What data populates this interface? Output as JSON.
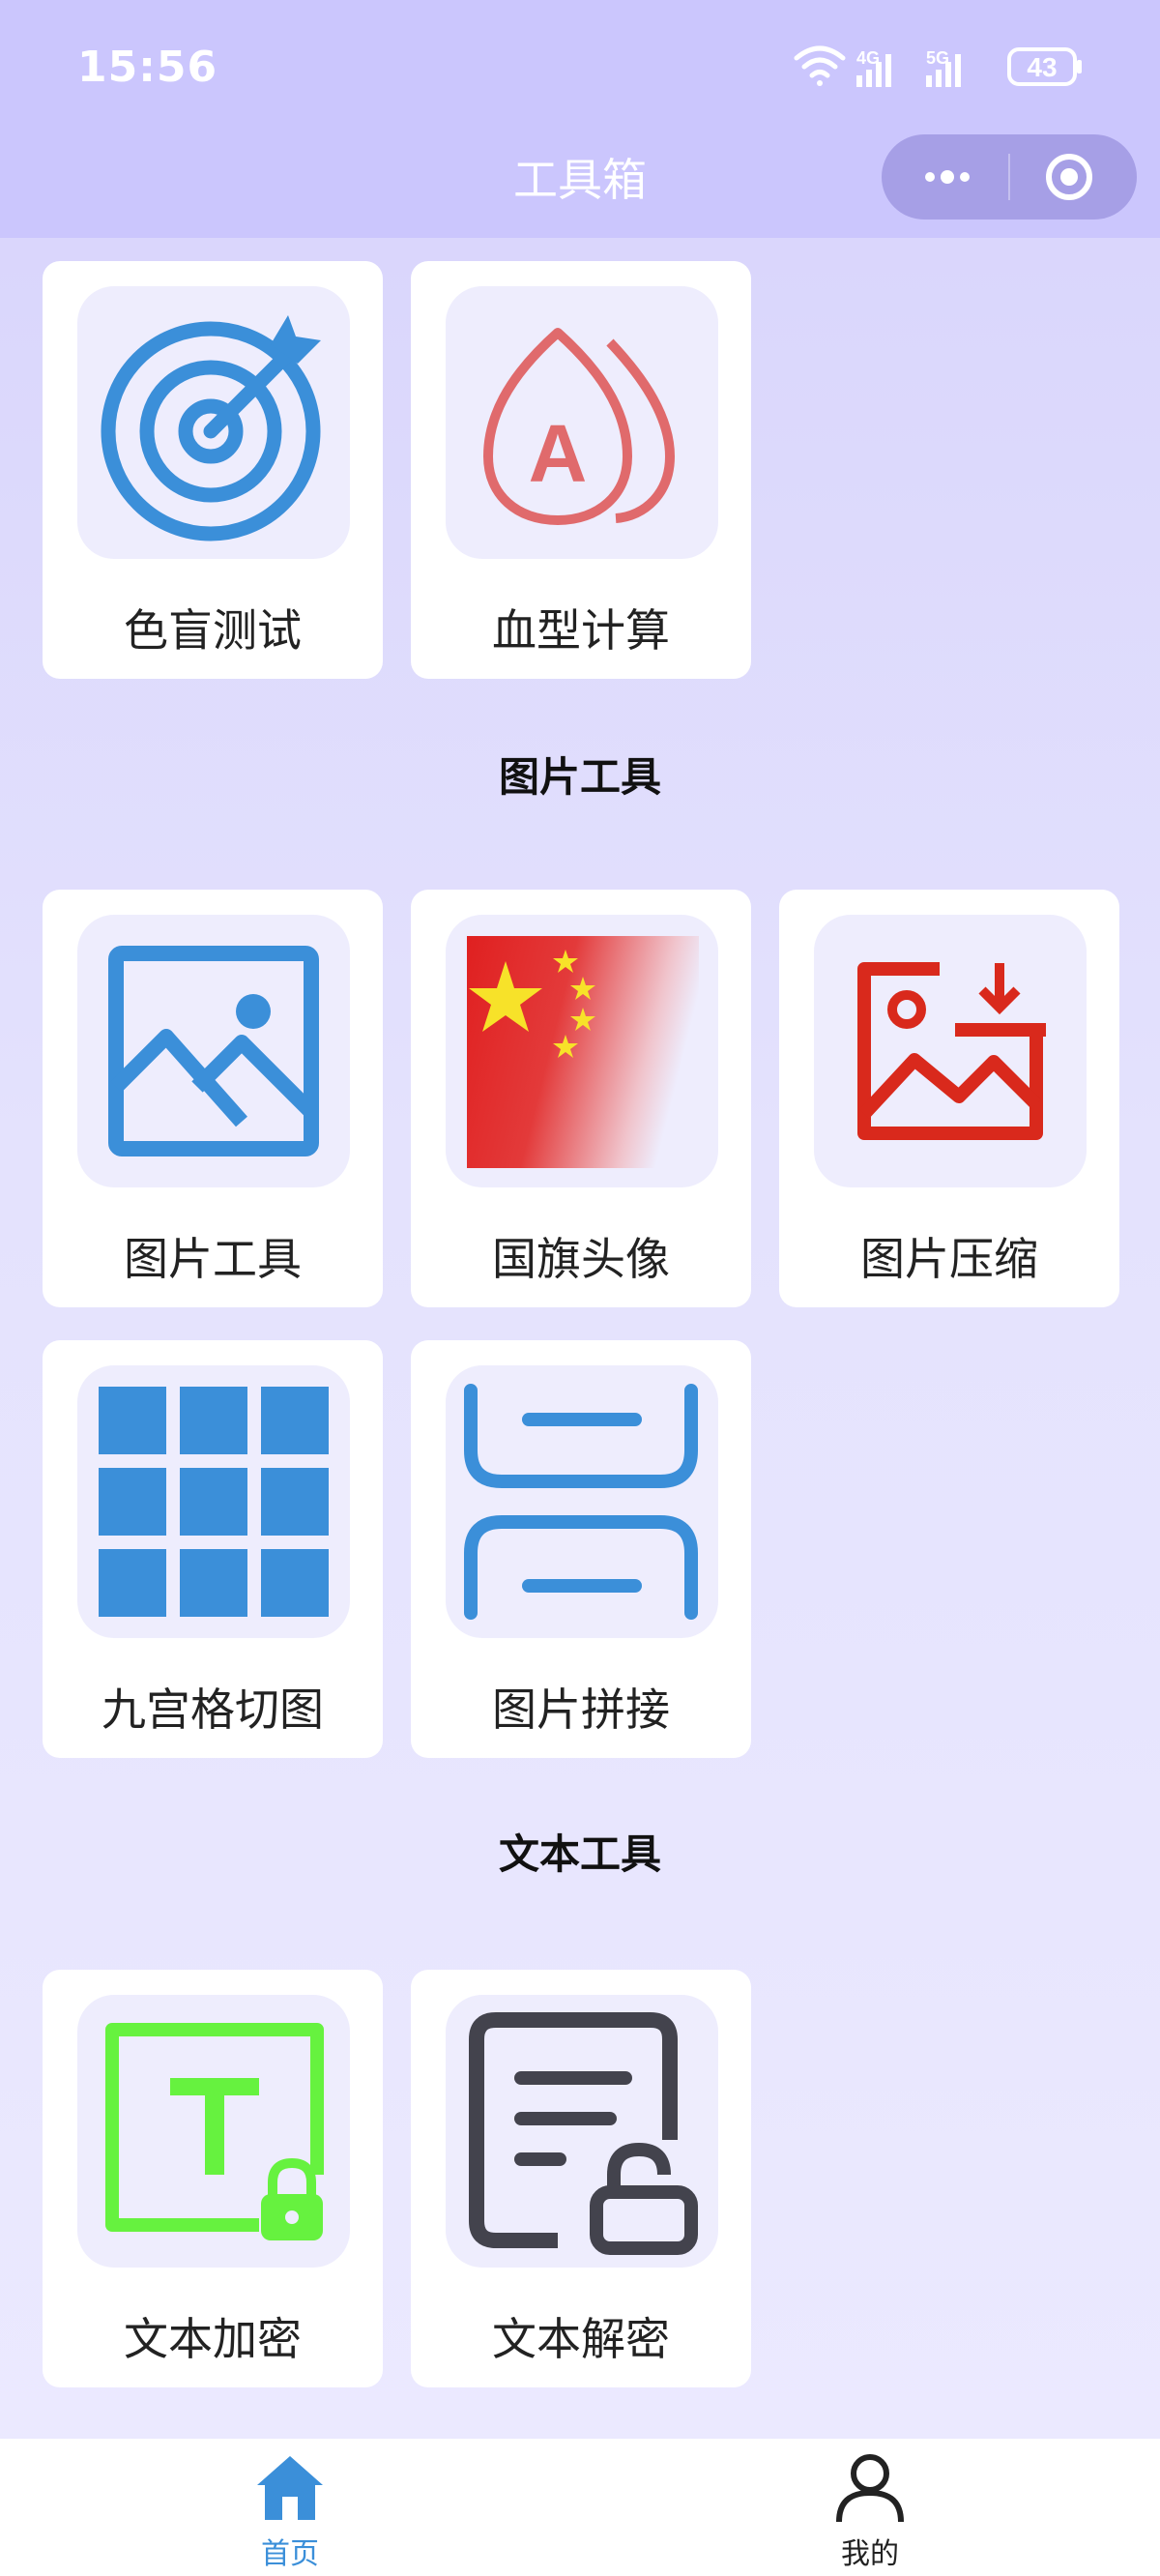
{
  "status_bar": {
    "time": "15:56",
    "network_1": "4G",
    "network_2": "5G",
    "battery": "43"
  },
  "nav": {
    "title": "工具箱"
  },
  "sections": {
    "misc": {
      "items": [
        {
          "label": "色盲测试",
          "icon": "target-icon"
        },
        {
          "label": "血型计算",
          "icon": "blood-drop-icon"
        }
      ]
    },
    "image": {
      "title": "图片工具",
      "items": [
        {
          "label": "图片工具",
          "icon": "image-icon"
        },
        {
          "label": "国旗头像",
          "icon": "flag-icon"
        },
        {
          "label": "图片压缩",
          "icon": "image-compress-icon"
        },
        {
          "label": "九宫格切图",
          "icon": "grid-icon"
        },
        {
          "label": "图片拼接",
          "icon": "stitch-icon"
        }
      ]
    },
    "text": {
      "title": "文本工具",
      "items": [
        {
          "label": "文本加密",
          "icon": "text-lock-icon"
        },
        {
          "label": "文本解密",
          "icon": "document-unlock-icon"
        }
      ]
    }
  },
  "tabbar": {
    "home": "首页",
    "mine": "我的"
  },
  "colors": {
    "accent_blue": "#3b8fd9",
    "red": "#d9291c",
    "green": "#66f23f",
    "dark": "#43434d",
    "header": "#cbc6fd"
  }
}
